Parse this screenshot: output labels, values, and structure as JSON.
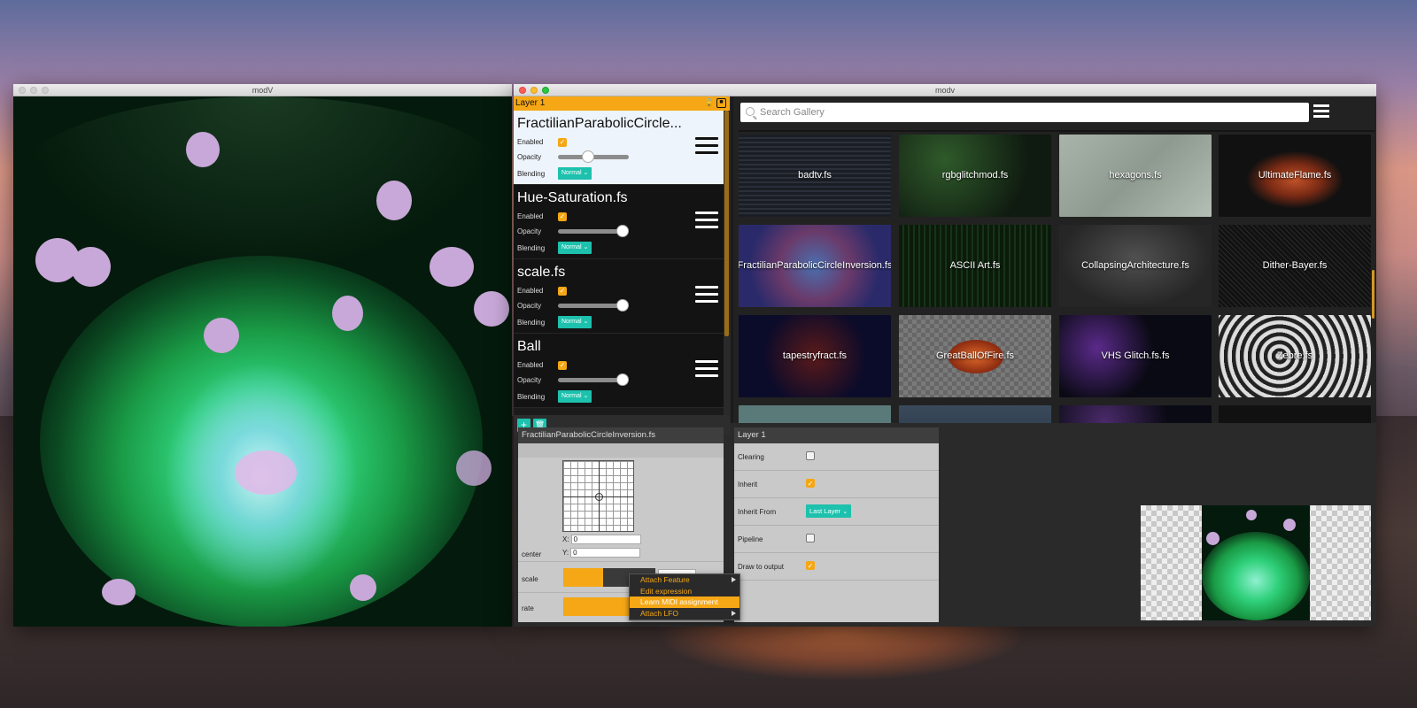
{
  "output_window": {
    "title": "modV"
  },
  "main_window": {
    "title": "modv"
  },
  "layer_panel": {
    "title": "Layer 1",
    "modules": [
      {
        "name": "FractilianParabolicCircle...",
        "enabled_label": "Enabled",
        "opacity_label": "Opacity",
        "blending_label": "Blending",
        "blend_mode": "Normal",
        "enabled": true,
        "opacity": 0.42,
        "active": true
      },
      {
        "name": "Hue-Saturation.fs",
        "enabled_label": "Enabled",
        "opacity_label": "Opacity",
        "blending_label": "Blending",
        "blend_mode": "Normal",
        "enabled": true,
        "opacity": 1.0,
        "active": false
      },
      {
        "name": "scale.fs",
        "enabled_label": "Enabled",
        "opacity_label": "Opacity",
        "blending_label": "Blending",
        "blend_mode": "Normal",
        "enabled": true,
        "opacity": 1.0,
        "active": false
      },
      {
        "name": "Ball",
        "enabled_label": "Enabled",
        "opacity_label": "Opacity",
        "blending_label": "Blending",
        "blend_mode": "Normal",
        "enabled": true,
        "opacity": 1.0,
        "active": false
      }
    ],
    "add_icon": "plus-icon",
    "delete_icon": "trash-icon"
  },
  "gallery": {
    "search_placeholder": "Search Gallery",
    "tiles": [
      "badtv.fs",
      "rgbglitchmod.fs",
      "hexagons.fs",
      "UltimateFlame.fs",
      "FractilianParabolicCircleInversion.fs",
      "ASCII Art.fs",
      "CollapsingArchitecture.fs",
      "Dither-Bayer.fs",
      "tapestryfract.fs",
      "GreatBallOfFire.fs",
      "VHS Glitch.fs.fs",
      "Zebre.fs"
    ]
  },
  "controls_panel": {
    "title": "FractilianParabolicCircleInversion.fs",
    "center_label": "center",
    "x_label": "X:",
    "x_value": "0",
    "y_label": "Y:",
    "y_value": "0",
    "scale_label": "scale",
    "rate_label": "rate"
  },
  "context_menu": {
    "items": [
      {
        "label": "Attach Feature",
        "submenu": true,
        "highlighted": false
      },
      {
        "label": "Edit expression",
        "submenu": false,
        "highlighted": false
      },
      {
        "label": "Learn MIDI assignment",
        "submenu": false,
        "highlighted": true
      },
      {
        "label": "Attach LFO",
        "submenu": true,
        "highlighted": false
      }
    ]
  },
  "layer_settings": {
    "title": "Layer 1",
    "clearing_label": "Clearing",
    "clearing": false,
    "inherit_label": "Inherit",
    "inherit": true,
    "inherit_from_label": "Inherit From",
    "inherit_from_value": "Last Layer",
    "pipeline_label": "Pipeline",
    "pipeline": false,
    "draw_to_output_label": "Draw to output",
    "draw_to_output": true
  },
  "colors": {
    "accent_orange": "#f5a715",
    "accent_teal": "#1dc1ad"
  }
}
